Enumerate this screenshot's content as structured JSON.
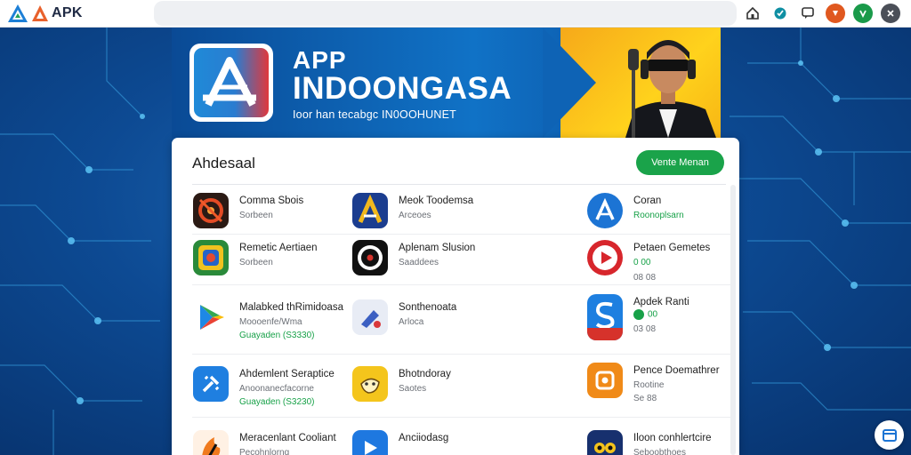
{
  "brand": {
    "name": "APK"
  },
  "topbar": {
    "icons": [
      "home-icon",
      "verified-icon",
      "chat-icon",
      "user-orange-icon",
      "user-green-icon",
      "close-icon"
    ],
    "colors": {
      "orange": "#e0581f",
      "green": "#1a9a4a",
      "gray": "#4b4f58"
    }
  },
  "hero": {
    "title_line1": "APP",
    "title_line2": "INDOONGASA",
    "subtitle": "Ioor han tecabgc IN0OOHUNET"
  },
  "panel": {
    "title": "Ahdesaal",
    "button": "Vente Menan",
    "apps": [
      {
        "name": "Comma Sbois",
        "meta": "Sorbeen",
        "meta2": "",
        "icon": "target-icon"
      },
      {
        "name": "Meok Toodemsa",
        "meta": "Arceoes",
        "meta2": "",
        "icon": "a-logo-icon"
      },
      {
        "name": "Coran",
        "meta": "Roonoplsarn",
        "meta2": "",
        "icon": "a-circle-icon"
      },
      {
        "name": "Remetic Aertiaen",
        "meta": "Sorbeen",
        "meta2": "",
        "icon": "game-icon"
      },
      {
        "name": "Aplenam Slusion",
        "meta": "Saaddees",
        "meta2": "",
        "icon": "vinyl-icon"
      },
      {
        "name": "Petaen Gemetes",
        "meta": "0 00",
        "meta2": "08 08",
        "icon": "play-icon"
      },
      {
        "name": "Malabked thRimidoasa",
        "meta": "Moooenfe/Wma",
        "meta2": "Guayaden (S3330)",
        "icon": "play-store-icon"
      },
      {
        "name": "Sonthenoata",
        "meta": "Arloca",
        "meta2": "",
        "icon": "cube-icon"
      },
      {
        "name": "Apdek Ranti",
        "meta": "00",
        "meta2": "03 08",
        "icon": "s-logo-icon"
      },
      {
        "name": "Ahdemlent Seraptice",
        "meta": "Anoonanecfacorne",
        "meta2": "Guayaden (S3230)",
        "icon": "plug-icon"
      },
      {
        "name": "Bhotndoray",
        "meta": "Saotes",
        "meta2": "",
        "icon": "hand-icon"
      },
      {
        "name": "Pence Doemathrer",
        "meta": "Rootine",
        "meta2": "Se 88",
        "icon": "orange-box-icon"
      },
      {
        "name": "Meracenlant Cooliant",
        "meta": "Pecohnlorng",
        "meta2": "",
        "icon": "flame-icon"
      },
      {
        "name": "Anciiodasg",
        "meta": "",
        "meta2": "",
        "icon": "pen-icon"
      },
      {
        "name": "Iloon conhlertcire",
        "meta": "Seboobthoes",
        "meta2": "",
        "icon": "owl-icon"
      }
    ]
  }
}
